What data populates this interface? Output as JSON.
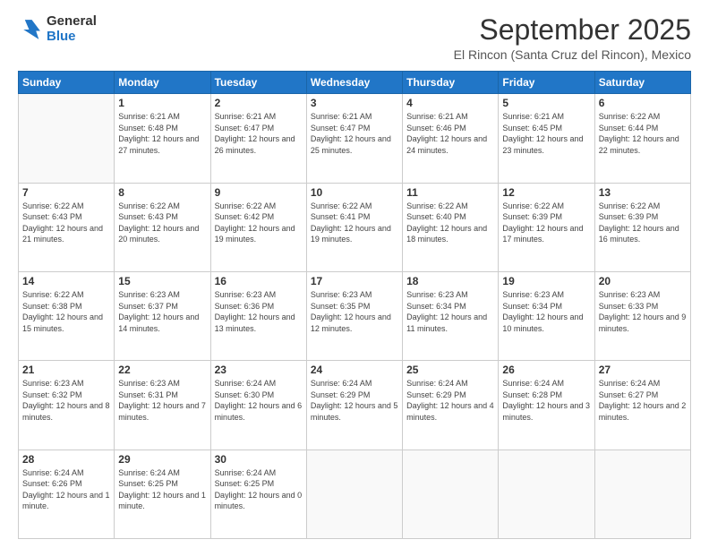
{
  "logo": {
    "general": "General",
    "blue": "Blue"
  },
  "header": {
    "month": "September 2025",
    "location": "El Rincon (Santa Cruz del Rincon), Mexico"
  },
  "columns": [
    "Sunday",
    "Monday",
    "Tuesday",
    "Wednesday",
    "Thursday",
    "Friday",
    "Saturday"
  ],
  "weeks": [
    [
      {
        "day": "",
        "sunrise": "",
        "sunset": "",
        "daylight": ""
      },
      {
        "day": "1",
        "sunrise": "Sunrise: 6:21 AM",
        "sunset": "Sunset: 6:48 PM",
        "daylight": "Daylight: 12 hours and 27 minutes."
      },
      {
        "day": "2",
        "sunrise": "Sunrise: 6:21 AM",
        "sunset": "Sunset: 6:47 PM",
        "daylight": "Daylight: 12 hours and 26 minutes."
      },
      {
        "day": "3",
        "sunrise": "Sunrise: 6:21 AM",
        "sunset": "Sunset: 6:47 PM",
        "daylight": "Daylight: 12 hours and 25 minutes."
      },
      {
        "day": "4",
        "sunrise": "Sunrise: 6:21 AM",
        "sunset": "Sunset: 6:46 PM",
        "daylight": "Daylight: 12 hours and 24 minutes."
      },
      {
        "day": "5",
        "sunrise": "Sunrise: 6:21 AM",
        "sunset": "Sunset: 6:45 PM",
        "daylight": "Daylight: 12 hours and 23 minutes."
      },
      {
        "day": "6",
        "sunrise": "Sunrise: 6:22 AM",
        "sunset": "Sunset: 6:44 PM",
        "daylight": "Daylight: 12 hours and 22 minutes."
      }
    ],
    [
      {
        "day": "7",
        "sunrise": "Sunrise: 6:22 AM",
        "sunset": "Sunset: 6:43 PM",
        "daylight": "Daylight: 12 hours and 21 minutes."
      },
      {
        "day": "8",
        "sunrise": "Sunrise: 6:22 AM",
        "sunset": "Sunset: 6:43 PM",
        "daylight": "Daylight: 12 hours and 20 minutes."
      },
      {
        "day": "9",
        "sunrise": "Sunrise: 6:22 AM",
        "sunset": "Sunset: 6:42 PM",
        "daylight": "Daylight: 12 hours and 19 minutes."
      },
      {
        "day": "10",
        "sunrise": "Sunrise: 6:22 AM",
        "sunset": "Sunset: 6:41 PM",
        "daylight": "Daylight: 12 hours and 19 minutes."
      },
      {
        "day": "11",
        "sunrise": "Sunrise: 6:22 AM",
        "sunset": "Sunset: 6:40 PM",
        "daylight": "Daylight: 12 hours and 18 minutes."
      },
      {
        "day": "12",
        "sunrise": "Sunrise: 6:22 AM",
        "sunset": "Sunset: 6:39 PM",
        "daylight": "Daylight: 12 hours and 17 minutes."
      },
      {
        "day": "13",
        "sunrise": "Sunrise: 6:22 AM",
        "sunset": "Sunset: 6:39 PM",
        "daylight": "Daylight: 12 hours and 16 minutes."
      }
    ],
    [
      {
        "day": "14",
        "sunrise": "Sunrise: 6:22 AM",
        "sunset": "Sunset: 6:38 PM",
        "daylight": "Daylight: 12 hours and 15 minutes."
      },
      {
        "day": "15",
        "sunrise": "Sunrise: 6:23 AM",
        "sunset": "Sunset: 6:37 PM",
        "daylight": "Daylight: 12 hours and 14 minutes."
      },
      {
        "day": "16",
        "sunrise": "Sunrise: 6:23 AM",
        "sunset": "Sunset: 6:36 PM",
        "daylight": "Daylight: 12 hours and 13 minutes."
      },
      {
        "day": "17",
        "sunrise": "Sunrise: 6:23 AM",
        "sunset": "Sunset: 6:35 PM",
        "daylight": "Daylight: 12 hours and 12 minutes."
      },
      {
        "day": "18",
        "sunrise": "Sunrise: 6:23 AM",
        "sunset": "Sunset: 6:34 PM",
        "daylight": "Daylight: 12 hours and 11 minutes."
      },
      {
        "day": "19",
        "sunrise": "Sunrise: 6:23 AM",
        "sunset": "Sunset: 6:34 PM",
        "daylight": "Daylight: 12 hours and 10 minutes."
      },
      {
        "day": "20",
        "sunrise": "Sunrise: 6:23 AM",
        "sunset": "Sunset: 6:33 PM",
        "daylight": "Daylight: 12 hours and 9 minutes."
      }
    ],
    [
      {
        "day": "21",
        "sunrise": "Sunrise: 6:23 AM",
        "sunset": "Sunset: 6:32 PM",
        "daylight": "Daylight: 12 hours and 8 minutes."
      },
      {
        "day": "22",
        "sunrise": "Sunrise: 6:23 AM",
        "sunset": "Sunset: 6:31 PM",
        "daylight": "Daylight: 12 hours and 7 minutes."
      },
      {
        "day": "23",
        "sunrise": "Sunrise: 6:24 AM",
        "sunset": "Sunset: 6:30 PM",
        "daylight": "Daylight: 12 hours and 6 minutes."
      },
      {
        "day": "24",
        "sunrise": "Sunrise: 6:24 AM",
        "sunset": "Sunset: 6:29 PM",
        "daylight": "Daylight: 12 hours and 5 minutes."
      },
      {
        "day": "25",
        "sunrise": "Sunrise: 6:24 AM",
        "sunset": "Sunset: 6:29 PM",
        "daylight": "Daylight: 12 hours and 4 minutes."
      },
      {
        "day": "26",
        "sunrise": "Sunrise: 6:24 AM",
        "sunset": "Sunset: 6:28 PM",
        "daylight": "Daylight: 12 hours and 3 minutes."
      },
      {
        "day": "27",
        "sunrise": "Sunrise: 6:24 AM",
        "sunset": "Sunset: 6:27 PM",
        "daylight": "Daylight: 12 hours and 2 minutes."
      }
    ],
    [
      {
        "day": "28",
        "sunrise": "Sunrise: 6:24 AM",
        "sunset": "Sunset: 6:26 PM",
        "daylight": "Daylight: 12 hours and 1 minute."
      },
      {
        "day": "29",
        "sunrise": "Sunrise: 6:24 AM",
        "sunset": "Sunset: 6:25 PM",
        "daylight": "Daylight: 12 hours and 1 minute."
      },
      {
        "day": "30",
        "sunrise": "Sunrise: 6:24 AM",
        "sunset": "Sunset: 6:25 PM",
        "daylight": "Daylight: 12 hours and 0 minutes."
      },
      {
        "day": "",
        "sunrise": "",
        "sunset": "",
        "daylight": ""
      },
      {
        "day": "",
        "sunrise": "",
        "sunset": "",
        "daylight": ""
      },
      {
        "day": "",
        "sunrise": "",
        "sunset": "",
        "daylight": ""
      },
      {
        "day": "",
        "sunrise": "",
        "sunset": "",
        "daylight": ""
      }
    ]
  ]
}
